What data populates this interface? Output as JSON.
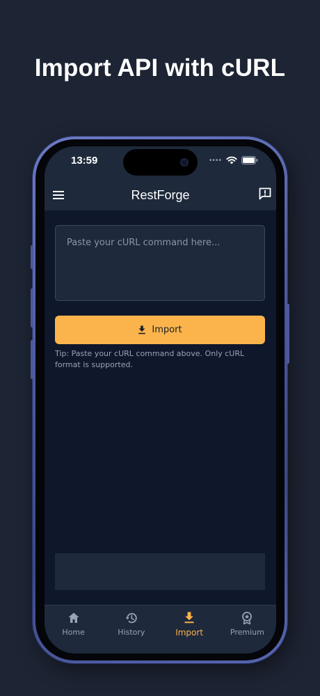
{
  "headline": "Import API with cURL",
  "status_bar": {
    "time": "13:59",
    "dots": "••••"
  },
  "app_bar": {
    "title": "RestForge",
    "menu_icon": "menu-icon",
    "feedback_icon": "feedback-icon"
  },
  "import_form": {
    "input_value": "",
    "input_placeholder": "Paste your cURL command here...",
    "button_label": "Import",
    "button_icon": "download-icon",
    "tip": "Tip: Paste your cURL command above. Only cURL format is supported."
  },
  "bottom_nav": {
    "active": "Import",
    "items": [
      {
        "label": "Home",
        "icon": "home-icon"
      },
      {
        "label": "History",
        "icon": "history-icon"
      },
      {
        "label": "Import",
        "icon": "download-icon"
      },
      {
        "label": "Premium",
        "icon": "premium-badge-icon"
      }
    ]
  },
  "colors": {
    "background": "#1d2433",
    "surface": "#1e293b",
    "screen": "#0f172a",
    "accent": "#fbb44c",
    "muted_text": "#9aa3b5"
  }
}
